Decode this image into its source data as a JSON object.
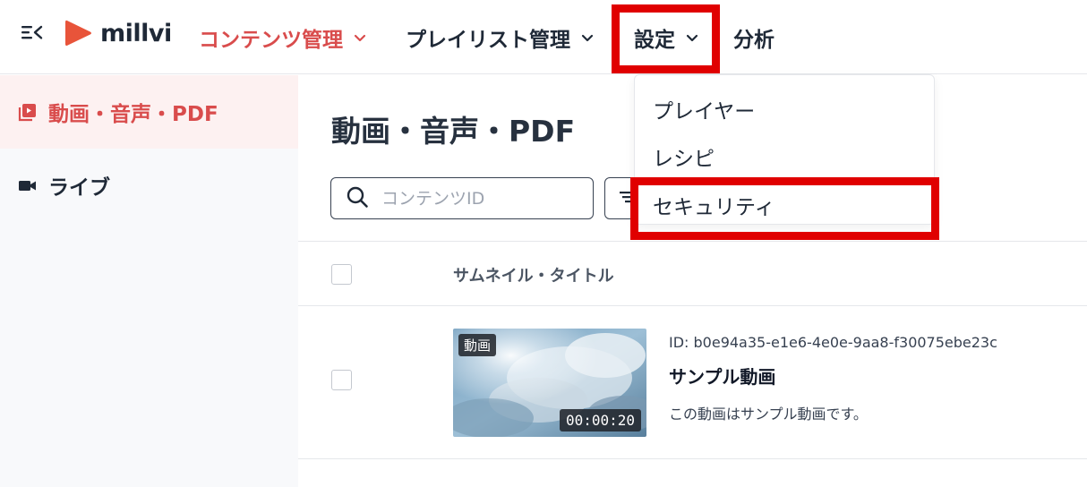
{
  "header": {
    "logo_text": "millvi",
    "nav": [
      {
        "label": "コンテンツ管理"
      },
      {
        "label": "プレイリスト管理"
      },
      {
        "label": "設定"
      },
      {
        "label": "分析"
      }
    ]
  },
  "dropdown": {
    "items": [
      {
        "label": "プレイヤー"
      },
      {
        "label": "レシピ"
      },
      {
        "label": "セキュリティ"
      }
    ]
  },
  "sidebar": {
    "items": [
      {
        "label": "動画・音声・PDF"
      },
      {
        "label": "ライブ"
      }
    ]
  },
  "main": {
    "title": "動画・音声・PDF",
    "search_placeholder": "コンテンツID",
    "table": {
      "column_header": "サムネイル・タイトル",
      "rows": [
        {
          "badge": "動画",
          "duration": "00:00:20",
          "id": "ID: b0e94a35-e1e6-4e0e-9aa8-f30075ebe23c",
          "title": "サンプル動画",
          "description": "この動画はサンプル動画です。"
        }
      ]
    }
  },
  "colors": {
    "accent": "#d94c4c",
    "highlight": "#e00000",
    "logo": "#e8543a"
  }
}
